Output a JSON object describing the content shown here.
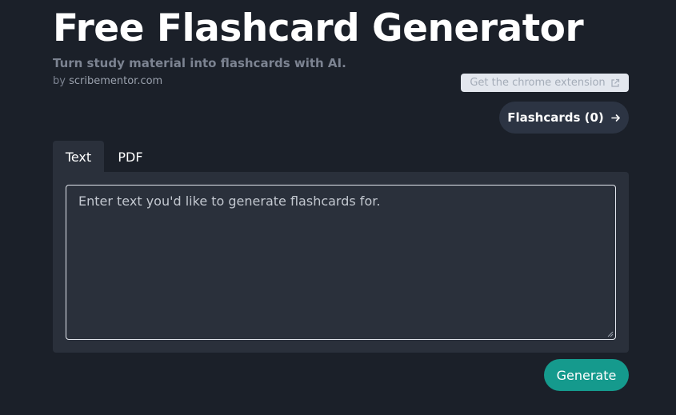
{
  "header": {
    "title": "Free Flashcard Generator",
    "subtitle": "Turn study material into flashcards with AI.",
    "byline_prefix": "by",
    "byline_site": "scribementor.com"
  },
  "actions": {
    "extension_label": "Get the chrome extension",
    "extension_icon": "external-link-icon",
    "flashcards_label": "Flashcards (0)",
    "flashcards_icon": "arrow-right-icon"
  },
  "tabs": [
    {
      "label": "Text",
      "active": true
    },
    {
      "label": "PDF",
      "active": false
    }
  ],
  "input": {
    "value": "",
    "placeholder": "Enter text you'd like to generate flashcards for."
  },
  "generate_label": "Generate",
  "colors": {
    "background": "#1b2029",
    "panel": "#2a303b",
    "accent": "#159a8d",
    "pill": "#2c3443",
    "muted_text": "#7c8391"
  }
}
